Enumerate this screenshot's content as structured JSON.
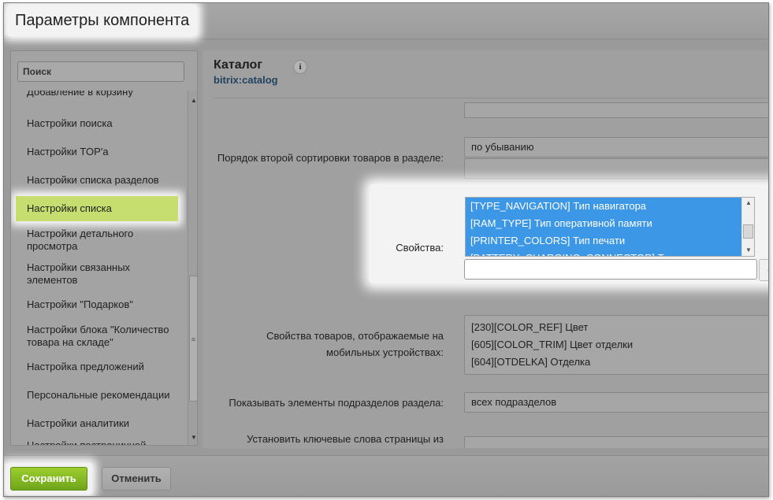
{
  "dialog": {
    "title": "Параметры компонента"
  },
  "sidebar": {
    "search_placeholder": "Поиск",
    "items": [
      {
        "label": "Добавление в корзину"
      },
      {
        "label": "Настройки поиска"
      },
      {
        "label": "Настройки TOP'а"
      },
      {
        "label": "Настройки списка разделов"
      },
      {
        "label": "Настройки списка",
        "active": true
      },
      {
        "label": "Настройки детального просмотра"
      },
      {
        "label": "Настройки связанных элементов"
      },
      {
        "label": "Настройки \"Подарков\""
      },
      {
        "label": "Настройки блока \"Количество товара на складе\""
      },
      {
        "label": "Настройка предложений"
      },
      {
        "label": "Персональные рекомендации"
      },
      {
        "label": "Настройки аналитики"
      },
      {
        "label": "Настройки постраничной"
      }
    ]
  },
  "component": {
    "name": "Каталог",
    "code": "bitrix:catalog",
    "info_icon": "i"
  },
  "fields": {
    "second_sort_order": {
      "label": "Порядок второй сортировки товаров в разделе:",
      "value": "по убыванию"
    },
    "properties": {
      "label": "Свойства:",
      "options": [
        "[TYPE_NAVIGATION] Тип навигатора",
        "[RAM_TYPE] Тип оперативной памяти",
        "[PRINTER_COLORS] Тип печати",
        "[BATTERY_CHARGING_CONNECTOR] Тип разъема для"
      ],
      "add_input_value": "",
      "add_button": "+"
    },
    "mobile_properties": {
      "label_line1": "Свойства товаров, отображаемые на",
      "label_line2": "мобильных устройствах:",
      "options": [
        "[230][COLOR_REF] Цвет",
        "[605][COLOR_TRIM] Цвет отделки",
        "[604][OTDELKA] Отделка"
      ]
    },
    "subsection_elements": {
      "label": "Показывать элементы подразделов раздела:",
      "value": "всех подразделов"
    },
    "meta_keywords": {
      "label": "Установить ключевые слова страницы из"
    }
  },
  "footer": {
    "save_label": "Сохранить",
    "cancel_label": "Отменить"
  }
}
